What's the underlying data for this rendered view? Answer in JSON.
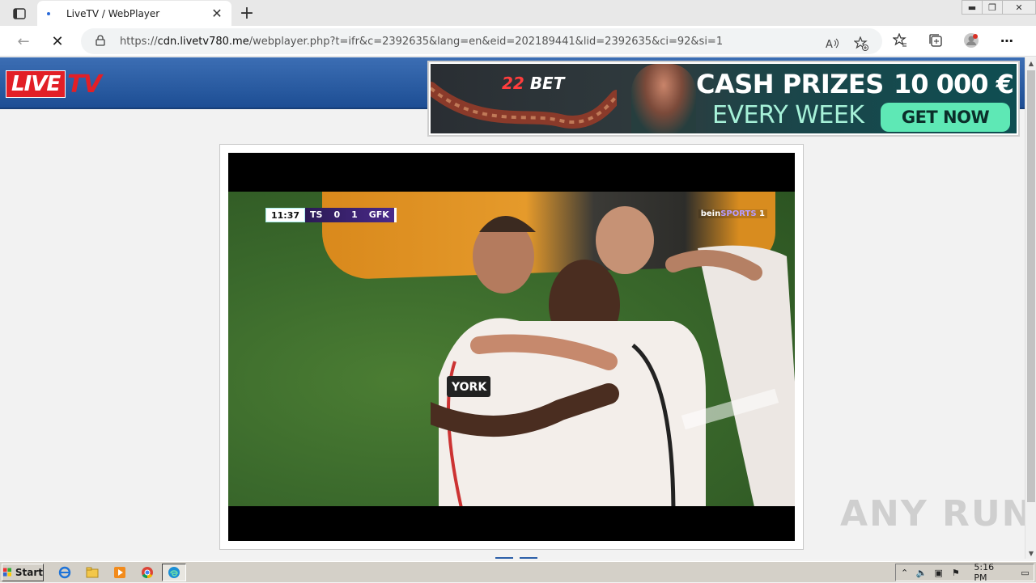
{
  "browser": {
    "tab_title": "LiveTV / WebPlayer",
    "new_tab_symbol": "+",
    "url_prefix": "https://",
    "url_host": "cdn.livetv780.me",
    "url_path": "/webplayer.php?t=ifr&c=2392635&lang=en&eid=202189441&lid=2392635&ci=92&si=1"
  },
  "page": {
    "logo_live": "LIVE",
    "logo_tv": "TV",
    "banner": {
      "brand_left": "22",
      "brand_right": "BET",
      "headline_1": "CASH PRIZES",
      "amount": "10 000 €",
      "headline_2": "EVERY WEEK",
      "cta": "GET NOW"
    },
    "video": {
      "clock": "11:37",
      "home_team": "TS",
      "home_score": "0",
      "away_score": "1",
      "away_team": "GFK",
      "channel_brand": "bein",
      "channel_name": "SPORTS",
      "channel_number": "1"
    }
  },
  "watermark": "ANY RUN",
  "taskbar": {
    "start_label": "Start",
    "clock": "5:16 PM"
  },
  "icons": [
    "tab-actions-icon",
    "close-icon",
    "back-icon",
    "stop-icon",
    "lock-icon",
    "read-aloud-icon",
    "add-favorite-icon",
    "favorites-icon",
    "collections-icon",
    "profile-icon",
    "more-icon"
  ]
}
